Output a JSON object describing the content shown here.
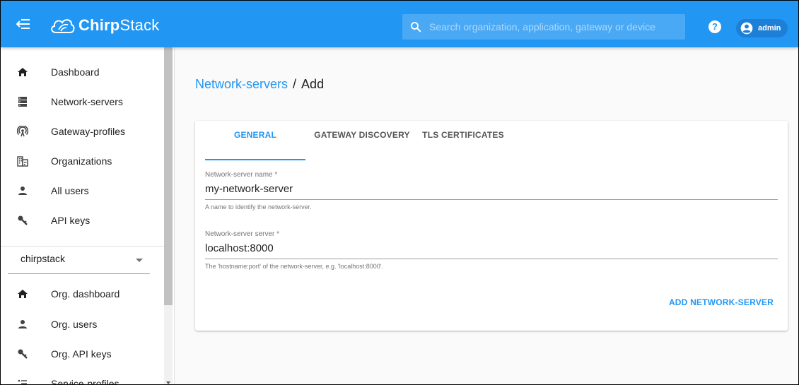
{
  "header": {
    "brand_bold": "Chirp",
    "brand_regular": "Stack",
    "search_placeholder": "Search organization, application, gateway or device",
    "help_label": "?",
    "user": "admin"
  },
  "sidebar": {
    "items": [
      {
        "label": "Dashboard",
        "icon": "home-icon"
      },
      {
        "label": "Network-servers",
        "icon": "server-icon"
      },
      {
        "label": "Gateway-profiles",
        "icon": "antenna-icon"
      },
      {
        "label": "Organizations",
        "icon": "building-icon"
      },
      {
        "label": "All users",
        "icon": "person-icon"
      },
      {
        "label": "API keys",
        "icon": "key-icon"
      }
    ],
    "org_select": "chirpstack",
    "org_items": [
      {
        "label": "Org. dashboard",
        "icon": "home-icon"
      },
      {
        "label": "Org. users",
        "icon": "person-icon"
      },
      {
        "label": "Org. API keys",
        "icon": "key-icon"
      },
      {
        "label": "Service-profiles",
        "icon": "list-icon"
      }
    ]
  },
  "breadcrumb": {
    "parent": "Network-servers",
    "separator": "/",
    "current": "Add"
  },
  "tabs": [
    {
      "label": "GENERAL",
      "active": true
    },
    {
      "label": "GATEWAY DISCOVERY",
      "active": false
    },
    {
      "label": "TLS CERTIFICATES",
      "active": false
    }
  ],
  "form": {
    "name": {
      "label": "Network-server name *",
      "value": "my-network-server",
      "help": "A name to identify the network-server."
    },
    "server": {
      "label": "Network-server server *",
      "value": "localhost:8000",
      "help": "The 'hostname:port' of the network-server, e.g. 'localhost:8000'."
    },
    "submit_label": "ADD NETWORK-SERVER"
  },
  "colors": {
    "primary": "#2196f3",
    "text": "#212121",
    "muted": "#757575"
  }
}
